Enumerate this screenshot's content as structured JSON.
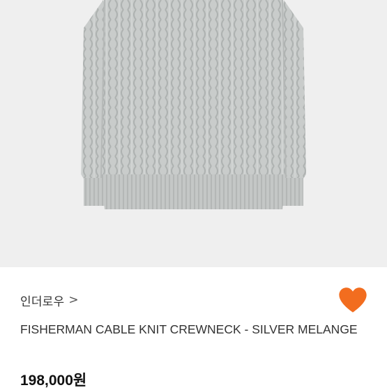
{
  "product": {
    "image_label": "sweater-photo",
    "brand": "인더로우",
    "brand_chevron": ">",
    "title": "FISHERMAN CABLE KNIT CREWNECK - SILVER MELANGE",
    "price": "198,000원",
    "liked": true
  },
  "colors": {
    "photo_bg": "#efefef",
    "sweater": "#c9cccb",
    "heart": "#f26d1f"
  },
  "icons": {
    "like": "heart-icon",
    "brand_link": "chevron-right-icon"
  }
}
